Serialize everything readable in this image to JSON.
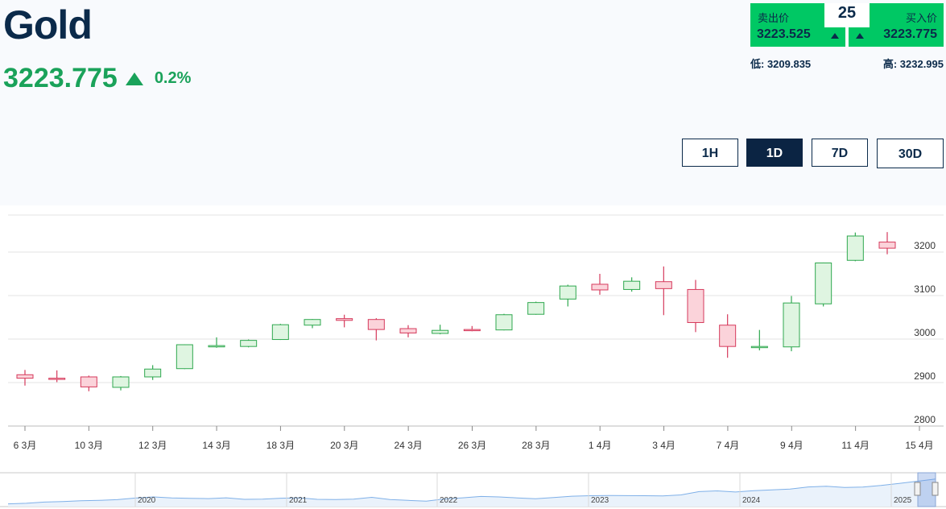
{
  "header": {
    "title": "Gold",
    "price": "3223.775",
    "change": "0.2%"
  },
  "quote": {
    "sell_label": "卖出价",
    "sell_value": "3223.525",
    "spread": "25",
    "buy_label": "买入价",
    "buy_value": "3223.775",
    "low": "低: 3209.835",
    "high": "高: 3232.995"
  },
  "periods": [
    "1H",
    "1D",
    "7D",
    "30D"
  ],
  "active_period": "1D",
  "colors": {
    "up_fill": "#dff5e1",
    "up_stroke": "#2fa84f",
    "down_fill": "#fbd3da",
    "down_stroke": "#d63a5c",
    "accent_green": "#1aa25a",
    "quote_green": "#00c864",
    "navy": "#0b2a4a"
  },
  "chart_data": {
    "type": "candlestick",
    "y_ticks": [
      2800,
      2900,
      3000,
      3100,
      3200
    ],
    "ylim": [
      2800,
      3250
    ],
    "x_ticks": [
      "6 3月",
      "10 3月",
      "12 3月",
      "14 3月",
      "18 3月",
      "20 3月",
      "24 3月",
      "26 3月",
      "28 3月",
      "1 4月",
      "3 4月",
      "7 4月",
      "9 4月",
      "11 4月",
      "15 4月"
    ],
    "candles": [
      {
        "o": 2918,
        "h": 2929,
        "l": 2893,
        "c": 2910
      },
      {
        "o": 2910,
        "h": 2928,
        "l": 2901,
        "c": 2908
      },
      {
        "o": 2913,
        "h": 2916,
        "l": 2880,
        "c": 2890
      },
      {
        "o": 2889,
        "h": 2915,
        "l": 2882,
        "c": 2913
      },
      {
        "o": 2913,
        "h": 2940,
        "l": 2906,
        "c": 2931
      },
      {
        "o": 2932,
        "h": 2988,
        "l": 2931,
        "c": 2987
      },
      {
        "o": 2982,
        "h": 3004,
        "l": 2980,
        "c": 2985
      },
      {
        "o": 2983,
        "h": 2999,
        "l": 2981,
        "c": 2997
      },
      {
        "o": 2999,
        "h": 3035,
        "l": 2998,
        "c": 3033
      },
      {
        "o": 3032,
        "h": 3046,
        "l": 3025,
        "c": 3045
      },
      {
        "o": 3047,
        "h": 3056,
        "l": 3027,
        "c": 3043
      },
      {
        "o": 3045,
        "h": 3048,
        "l": 2997,
        "c": 3022
      },
      {
        "o": 3024,
        "h": 3032,
        "l": 3004,
        "c": 3014
      },
      {
        "o": 3013,
        "h": 3033,
        "l": 3011,
        "c": 3020
      },
      {
        "o": 3022,
        "h": 3030,
        "l": 3018,
        "c": 3020
      },
      {
        "o": 3021,
        "h": 3058,
        "l": 3020,
        "c": 3056
      },
      {
        "o": 3057,
        "h": 3086,
        "l": 3056,
        "c": 3084
      },
      {
        "o": 3092,
        "h": 3125,
        "l": 3075,
        "c": 3122
      },
      {
        "o": 3126,
        "h": 3150,
        "l": 3102,
        "c": 3113
      },
      {
        "o": 3114,
        "h": 3142,
        "l": 3109,
        "c": 3133
      },
      {
        "o": 3132,
        "h": 3167,
        "l": 3055,
        "c": 3116
      },
      {
        "o": 3114,
        "h": 3136,
        "l": 3016,
        "c": 3038
      },
      {
        "o": 3032,
        "h": 3057,
        "l": 2957,
        "c": 2983
      },
      {
        "o": 2982,
        "h": 3021,
        "l": 2974,
        "c": 2983
      },
      {
        "o": 2982,
        "h": 3099,
        "l": 2972,
        "c": 3083
      },
      {
        "o": 3081,
        "h": 3176,
        "l": 3075,
        "c": 3175
      },
      {
        "o": 3181,
        "h": 3245,
        "l": 3179,
        "c": 3237
      },
      {
        "o": 3223,
        "h": 3246,
        "l": 3195,
        "c": 3209
      }
    ],
    "navigator": {
      "year_labels": [
        "2020",
        "2021",
        "2022",
        "2023",
        "2024",
        "2025"
      ],
      "series": [
        1480,
        1520,
        1600,
        1640,
        1690,
        1720,
        1770,
        1880,
        1960,
        1890,
        1860,
        1840,
        1900,
        1790,
        1810,
        1870,
        1900,
        1790,
        1780,
        1800,
        1930,
        1780,
        1720,
        1660,
        1820,
        1900,
        1990,
        1960,
        1890,
        1830,
        1920,
        2010,
        2040,
        2060,
        2050,
        2040,
        2030,
        2100,
        2330,
        2380,
        2300,
        2390,
        2450,
        2500,
        2650,
        2700,
        2620,
        2640,
        2750,
        2900,
        3050,
        3200
      ]
    }
  }
}
